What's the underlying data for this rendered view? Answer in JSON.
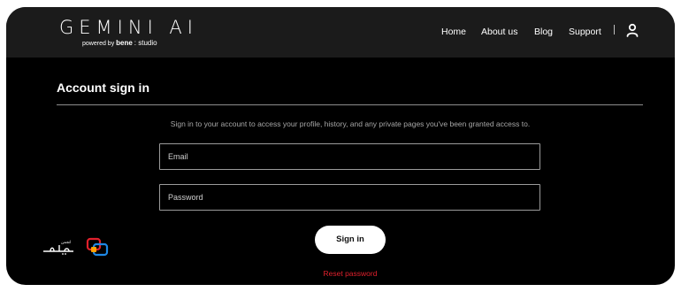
{
  "header": {
    "logo": "GEMINI AI",
    "tagline": {
      "prefix": "powered by",
      "brand": "bene",
      "suffix": ": studio"
    },
    "nav": [
      {
        "label": "Home"
      },
      {
        "label": "About us"
      },
      {
        "label": "Blog"
      },
      {
        "label": "Support"
      }
    ],
    "user_icon": "user-icon"
  },
  "main": {
    "title": "Account sign in",
    "intro": "Sign in to your account to access your profile, history, and any private pages you've been granted access to.",
    "email": {
      "placeholder": "Email",
      "value": ""
    },
    "password": {
      "placeholder": "Password",
      "value": ""
    },
    "signin_label": "Sign in",
    "reset_label": "Reset password"
  },
  "watermark": {
    "text": "آیاتک",
    "icon": "aptek-logo-icon"
  },
  "colors": {
    "background": "#000000",
    "header": "#1b1b1b",
    "text": "#ffffff",
    "muted": "#a6a6a6",
    "field_border": "#9b9b9b",
    "link": "#e0202c"
  }
}
